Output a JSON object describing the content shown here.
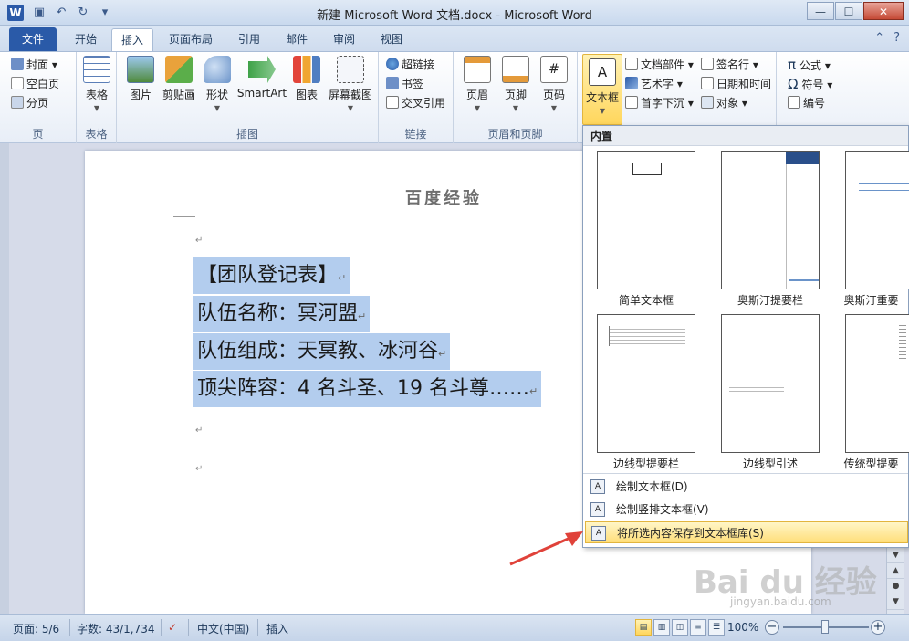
{
  "window": {
    "title": "新建 Microsoft Word 文档.docx - Microsoft Word",
    "logo": "W",
    "controls": [
      "—",
      "☐",
      "✕"
    ]
  },
  "tabs": [
    {
      "label": "文件"
    },
    {
      "label": "开始"
    },
    {
      "label": "插入"
    },
    {
      "label": "页面布局"
    },
    {
      "label": "引用"
    },
    {
      "label": "邮件"
    },
    {
      "label": "审阅"
    },
    {
      "label": "视图"
    }
  ],
  "ribbon": {
    "groups": {
      "page": {
        "label": "页",
        "cover": "封面",
        "blank": "空白页",
        "break": "分页"
      },
      "table": {
        "label": "表格",
        "table": "表格"
      },
      "illus": {
        "label": "插图",
        "picture": "图片",
        "clipart": "剪贴画",
        "shapes": "形状",
        "smartart": "SmartArt",
        "chart": "图表",
        "screenshot": "屏幕截图"
      },
      "links": {
        "label": "链接",
        "hyperlink": "超链接",
        "bookmark": "书签",
        "crossref": "交叉引用"
      },
      "hf": {
        "label": "页眉和页脚",
        "header": "页眉",
        "footer": "页脚",
        "pagenum": "页码"
      },
      "text": {
        "textbox": "文本框",
        "quickparts": "文档部件",
        "wordart": "艺术字",
        "dropcap": "首字下沉",
        "signature": "签名行",
        "datetime": "日期和时间",
        "object": "对象"
      },
      "symbols": {
        "equation": "公式",
        "symbol": "符号",
        "number": "编号"
      }
    }
  },
  "document": {
    "header": "百度经验",
    "lines": [
      "【团队登记表】",
      "队伍名称：冥河盟",
      "队伍组成：天冥教、冰河谷",
      "顶尖阵容：4 名斗圣、19 名斗尊……"
    ],
    "para_mark": "↵"
  },
  "dropdown": {
    "section": "内置",
    "items": [
      {
        "label": "简单文本框"
      },
      {
        "label": "奥斯汀提要栏"
      },
      {
        "label": "奥斯汀重要"
      },
      {
        "label": "边线型提要栏"
      },
      {
        "label": "边线型引述"
      },
      {
        "label": "传统型提要"
      }
    ],
    "menu": [
      {
        "label": "绘制文本框(D)"
      },
      {
        "label": "绘制竖排文本框(V)"
      },
      {
        "label": "将所选内容保存到文本框库(S)"
      }
    ]
  },
  "status": {
    "page": "页面: 5/6",
    "words": "字数: 43/1,734",
    "language": "中文(中国)",
    "mode": "插入",
    "zoom": "100%"
  },
  "watermark": {
    "brand": "Bai du 经验",
    "url": "jingyan.baidu.com"
  },
  "colors": {
    "file_tab": "#2a5aa8",
    "selection": "#b3cdee",
    "highlight": "#ffd65c",
    "arrow": "#e0423a"
  }
}
